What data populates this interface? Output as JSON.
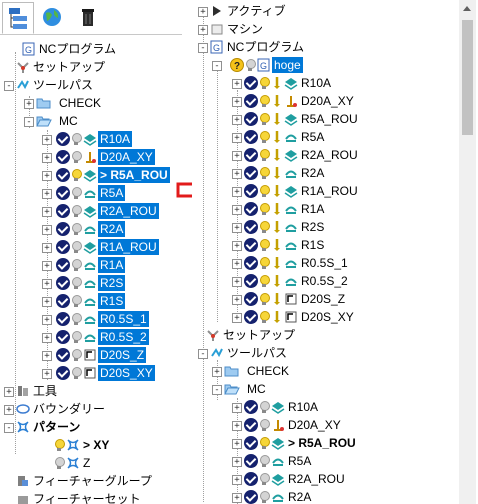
{
  "left": {
    "tabs": [
      {
        "icon": "tree-view-icon",
        "active": true
      },
      {
        "icon": "globe-icon",
        "active": false
      },
      {
        "icon": "trash-icon",
        "active": false
      }
    ],
    "nc_program": "NCプログラム",
    "setup": "セットアップ",
    "toolpath": "ツールパス",
    "check": "CHECK",
    "mc": "MC",
    "items": [
      "R10A",
      "D20A_XY",
      "> R5A_ROU",
      "R5A",
      "R2A_ROU",
      "R2A",
      "R1A_ROU",
      "R1A",
      "R2S",
      "R1S",
      "R0.5S_1",
      "R0.5S_2",
      "D20S_Z",
      "D20S_XY"
    ],
    "tools": "工具",
    "boundary": "バウンダリー",
    "pattern": "パターン",
    "xy": "> XY",
    "z": "Z",
    "feature_group": "フィーチャーグループ",
    "feature_set": "フィーチャーセット"
  },
  "right": {
    "active": "アクティブ",
    "machine": "マシン",
    "nc_program": "NCプログラム",
    "hoge": "hoge",
    "nc_items": [
      "R10A",
      "D20A_XY",
      "R5A_ROU",
      "R5A",
      "R2A_ROU",
      "R2A",
      "R1A_ROU",
      "R1A",
      "R2S",
      "R1S",
      "R0.5S_1",
      "R0.5S_2",
      "D20S_Z",
      "D20S_XY"
    ],
    "setup": "セットアップ",
    "toolpath": "ツールパス",
    "check": "CHECK",
    "mc": "MC",
    "tp_items": [
      "R10A",
      "D20A_XY",
      "> R5A_ROU",
      "R5A",
      "R2A_ROU",
      "R2A"
    ]
  },
  "colors": {
    "selection": "#0078d7",
    "check": "#15226e",
    "arrow": "#e21b1b"
  }
}
